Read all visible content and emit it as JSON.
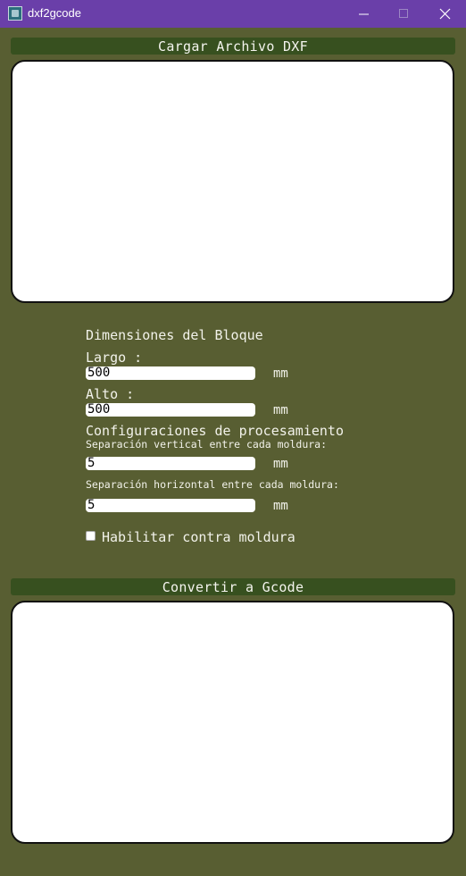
{
  "window": {
    "title": "dxf2gcode"
  },
  "load_button": {
    "label": "Cargar Archivo DXF"
  },
  "block": {
    "heading": "Dimensiones del Bloque",
    "largo_label": "Largo :",
    "largo_value": "500",
    "largo_unit": "mm",
    "alto_label": "Alto :",
    "alto_value": "500",
    "alto_unit": "mm"
  },
  "processing": {
    "heading": "Configuraciones de procesamiento",
    "vertical_label": "Separación vertical entre cada moldura:",
    "vertical_value": "5",
    "vertical_unit": "mm",
    "horizontal_label": "Separación horizontal entre cada moldura:",
    "horizontal_value": "5",
    "horizontal_unit": "mm",
    "checkbox_label": "Habilitar contra moldura",
    "checkbox_checked": false
  },
  "convert_button": {
    "label": "Convertir a Gcode"
  }
}
